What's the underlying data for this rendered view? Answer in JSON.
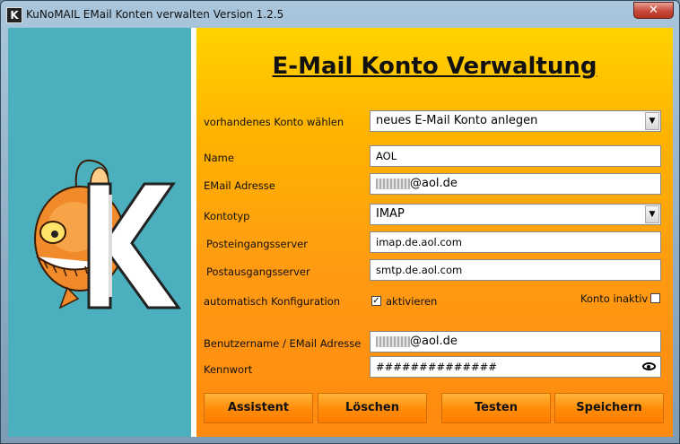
{
  "window": {
    "title": "KuNoMAIL EMail Konten verwalten Version 1.2.5",
    "app_icon_letter": "K",
    "close_glyph": "✕"
  },
  "heading": "E-Mail Konto Verwaltung",
  "form": {
    "account_select": {
      "label": "vorhandenes Konto wählen",
      "value": "neues E-Mail Konto anlegen"
    },
    "name": {
      "label": "Name",
      "value": "AOL"
    },
    "email": {
      "label": "EMail Adresse",
      "value_suffix": "@aol.de"
    },
    "account_type": {
      "label": "Kontotyp",
      "value": "IMAP"
    },
    "incoming_server": {
      "label": "Posteingangsserver",
      "value": "imap.de.aol.com"
    },
    "outgoing_server": {
      "label": "Postausgangsserver",
      "value": "smtp.de.aol.com"
    },
    "auto_config": {
      "label": "automatisch Konfiguration",
      "checkbox_label": "aktivieren",
      "checked": true
    },
    "inactive": {
      "label": "Konto inaktiv",
      "checked": false
    },
    "username": {
      "label": "Benutzername / EMail Adresse",
      "value_suffix": "@aol.de"
    },
    "password": {
      "label": "Kennwort",
      "value": "##############"
    }
  },
  "buttons": {
    "assistant": "Assistent",
    "delete": "Löschen",
    "test": "Testen",
    "save": "Speichern"
  },
  "mascot_letter": "K",
  "colors": {
    "side_panel": "#4bafbd",
    "main_gradient_top": "#ffd300",
    "main_gradient_bottom": "#ff8a10"
  }
}
